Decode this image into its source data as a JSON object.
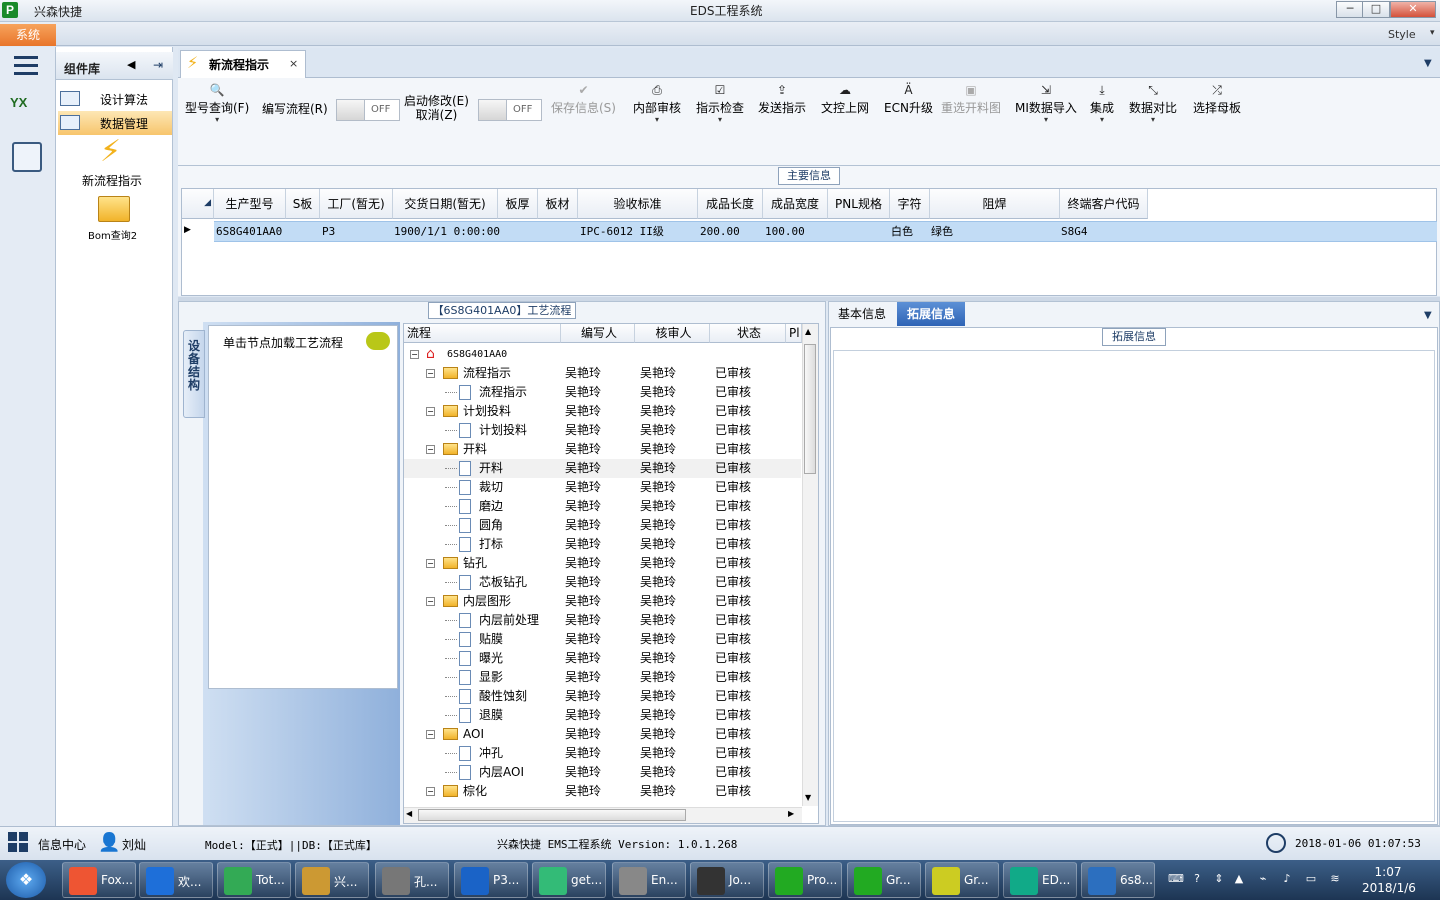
{
  "window": {
    "app_name": "兴森快捷",
    "title": "EDS工程系统",
    "min": "─",
    "max": "□",
    "close": "✕"
  },
  "menu": {
    "system": "系统",
    "style": "Style",
    "dropdown": "▾"
  },
  "components": {
    "title": "组件库",
    "items": [
      "设计算法",
      "数据管理"
    ],
    "tools": [
      {
        "label": "新流程指示"
      },
      {
        "label": "Bom查询2"
      }
    ]
  },
  "tab": {
    "label": "新流程指示",
    "close": "×"
  },
  "toolbar": {
    "type_query": "型号查询(F)",
    "write_flow": "编写流程(R)",
    "startup_modify_line1": "启动修改(E)",
    "startup_modify_line2": "取消(Z)",
    "toggle_off": "OFF",
    "save_info": "保存信息(S)",
    "internal_review": "内部审核",
    "guide_check": "指示检查",
    "send_guide": "发送指示",
    "doc_upload": "文控上网",
    "ecn_upgrade": "ECN升级",
    "redo_cut_map": "重选开料图",
    "mi_import": "MI数据导入",
    "integrate": "集成",
    "data_compare": "数据对比",
    "select_mother": "选择母板"
  },
  "main_info": {
    "title": "主要信息",
    "columns": [
      "生产型号",
      "S板",
      "工厂(暂无)",
      "交货日期(暂无)",
      "板厚",
      "板材",
      "验收标准",
      "成品长度",
      "成品宽度",
      "PNL规格",
      "字符",
      "阻焊",
      "终端客户代码"
    ],
    "row": [
      "6S8G401AA0",
      "P3",
      "1900/1/1 0:00:00",
      "",
      "",
      "IPC-6012 II级",
      "200.00",
      "100.00",
      "",
      "白色",
      "绿色",
      "S8G4"
    ]
  },
  "flow_panel": {
    "title": "【6S8G401AA0】工艺流程",
    "vertical_tab": "设备结构",
    "node_hint": "单击节点加载工艺流程",
    "columns": [
      "流程",
      "编写人",
      "核审人",
      "状态",
      "Pl"
    ],
    "root": "6S8G401AA0",
    "rows": [
      {
        "name": "流程指示",
        "folder": true,
        "w": "吴艳玲",
        "r": "吴艳玲",
        "s": "已审核"
      },
      {
        "name": "流程指示",
        "folder": false,
        "w": "吴艳玲",
        "r": "吴艳玲",
        "s": "已审核"
      },
      {
        "name": "计划投料",
        "folder": true,
        "w": "吴艳玲",
        "r": "吴艳玲",
        "s": "已审核"
      },
      {
        "name": "计划投料",
        "folder": false,
        "w": "吴艳玲",
        "r": "吴艳玲",
        "s": "已审核"
      },
      {
        "name": "开料",
        "folder": true,
        "w": "吴艳玲",
        "r": "吴艳玲",
        "s": "已审核"
      },
      {
        "name": "开料",
        "folder": false,
        "w": "吴艳玲",
        "r": "吴艳玲",
        "s": "已审核"
      },
      {
        "name": "裁切",
        "folder": false,
        "w": "吴艳玲",
        "r": "吴艳玲",
        "s": "已审核"
      },
      {
        "name": "磨边",
        "folder": false,
        "w": "吴艳玲",
        "r": "吴艳玲",
        "s": "已审核"
      },
      {
        "name": "圆角",
        "folder": false,
        "w": "吴艳玲",
        "r": "吴艳玲",
        "s": "已审核"
      },
      {
        "name": "打标",
        "folder": false,
        "w": "吴艳玲",
        "r": "吴艳玲",
        "s": "已审核"
      },
      {
        "name": "钻孔",
        "folder": true,
        "w": "吴艳玲",
        "r": "吴艳玲",
        "s": "已审核"
      },
      {
        "name": "芯板钻孔",
        "folder": false,
        "w": "吴艳玲",
        "r": "吴艳玲",
        "s": "已审核"
      },
      {
        "name": "内层图形",
        "folder": true,
        "w": "吴艳玲",
        "r": "吴艳玲",
        "s": "已审核"
      },
      {
        "name": "内层前处理",
        "folder": false,
        "w": "吴艳玲",
        "r": "吴艳玲",
        "s": "已审核"
      },
      {
        "name": "贴膜",
        "folder": false,
        "w": "吴艳玲",
        "r": "吴艳玲",
        "s": "已审核"
      },
      {
        "name": "曝光",
        "folder": false,
        "w": "吴艳玲",
        "r": "吴艳玲",
        "s": "已审核"
      },
      {
        "name": "显影",
        "folder": false,
        "w": "吴艳玲",
        "r": "吴艳玲",
        "s": "已审核"
      },
      {
        "name": "酸性蚀刻",
        "folder": false,
        "w": "吴艳玲",
        "r": "吴艳玲",
        "s": "已审核"
      },
      {
        "name": "退膜",
        "folder": false,
        "w": "吴艳玲",
        "r": "吴艳玲",
        "s": "已审核"
      },
      {
        "name": "AOI",
        "folder": true,
        "w": "吴艳玲",
        "r": "吴艳玲",
        "s": "已审核"
      },
      {
        "name": "冲孔",
        "folder": false,
        "w": "吴艳玲",
        "r": "吴艳玲",
        "s": "已审核"
      },
      {
        "name": "内层AOI",
        "folder": false,
        "w": "吴艳玲",
        "r": "吴艳玲",
        "s": "已审核"
      },
      {
        "name": "棕化",
        "folder": true,
        "w": "吴艳玲",
        "r": "吴艳玲",
        "s": "已审核"
      }
    ]
  },
  "ext_panel": {
    "tab_basic": "基本信息",
    "tab_ext": "拓展信息",
    "header": "拓展信息"
  },
  "status": {
    "info_center": "信息中心",
    "user": "刘灿",
    "model": "Model:【正式】||DB:【正式库】",
    "system": "兴森快捷 EMS工程系统 Version: 1.0.1.268",
    "datetime": "2018-01-06 01:07:53"
  },
  "taskbar": {
    "items": [
      "Fox...",
      "欢...",
      "Tot...",
      "兴...",
      "孔...",
      "P3...",
      "get...",
      "En...",
      "Jo...",
      "Pro...",
      "Gr...",
      "Gr...",
      "ED...",
      "6s8..."
    ],
    "time": "1:07",
    "date": "2018/1/6"
  },
  "colors": {
    "accent": "#2e63b5",
    "selected_row": "#c2dcf5",
    "system_tab": "#e8752a"
  }
}
